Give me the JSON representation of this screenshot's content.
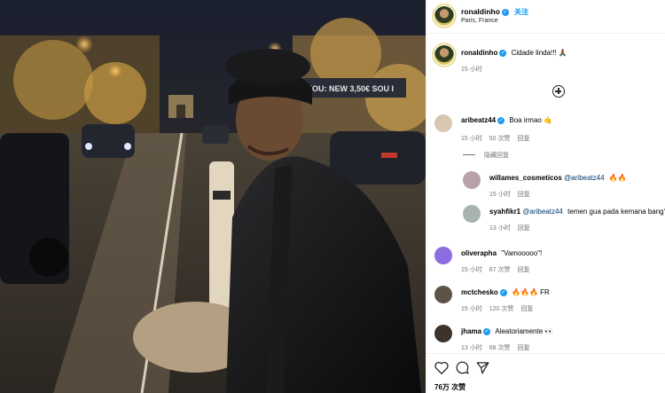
{
  "post": {
    "author": "ronaldinho",
    "follow_label": "关注",
    "location": "Paris, France",
    "caption": "Cidade linda!!! 🙏🏾",
    "caption_time": "15 小时",
    "likes_label": "76万 次赞",
    "photo_sign_text": "YOU: NEW 3,50€ SOU I"
  },
  "comments": [
    {
      "user": "aribeatz44",
      "text": "Boa irmao 🤙",
      "time": "15 小时",
      "likes": "50 次赞",
      "reply": "回复"
    },
    {
      "user": "willames_cosmeticos",
      "mention": "@aribeatz44",
      "text": "🔥🔥",
      "time": "15 小时",
      "reply": "回复"
    },
    {
      "user": "syahfikr1",
      "mention": "@aribeatz44",
      "text": "temen gua pada kemana bang?",
      "time": "13 小时",
      "reply": "回复"
    },
    {
      "user": "oliverapha",
      "text": "\"Vamooooo\"!",
      "time": "15 小时",
      "likes": "67 次赞",
      "reply": "回复"
    },
    {
      "user": "mctchesko",
      "text": "🔥🔥🔥 FR",
      "time": "15 小时",
      "likes": "120 次赞",
      "reply": "回复"
    },
    {
      "user": "jhama",
      "text": "Aleatoriamente 👀",
      "time": "13 小时",
      "likes": "68 次赞",
      "reply": "回复"
    }
  ],
  "hide_replies_label": "隐藏回复",
  "colors": {
    "accent": "#0095f6",
    "verified": "#1d9bf0",
    "muted": "#737373",
    "mention": "#00376b"
  },
  "icons": [
    "heart-icon",
    "comment-icon",
    "share-icon",
    "plus-circle-icon",
    "verified-icon"
  ]
}
